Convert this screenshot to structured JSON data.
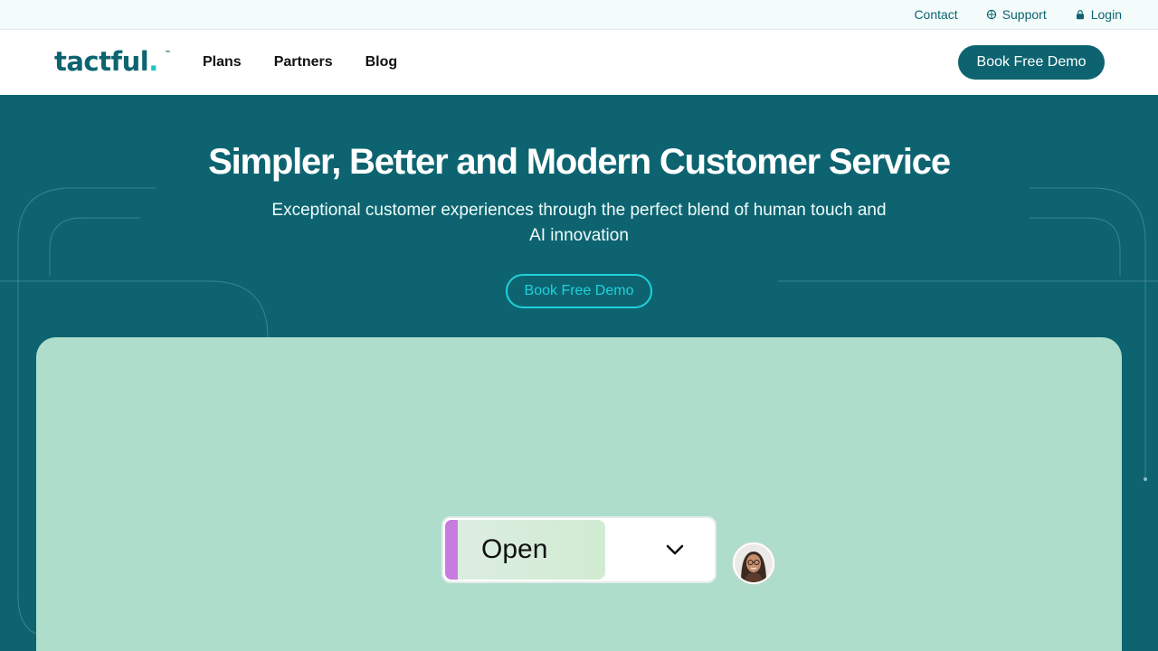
{
  "topbar": {
    "contact": "Contact",
    "support": "Support",
    "login": "Login",
    "icons": {
      "support": "globe-icon",
      "login": "lock-icon"
    }
  },
  "navbar": {
    "logo_text": "tactful",
    "logo_dot": ".",
    "logo_tm": "™",
    "links": [
      "Plans",
      "Partners",
      "Blog"
    ],
    "cta": "Book Free Demo"
  },
  "hero": {
    "title": "Simpler, Better and Modern Customer Service",
    "subtitle": "Exceptional customer experiences through the perfect blend of human touch and AI innovation",
    "cta": "Book Free Demo"
  },
  "showcase": {
    "status_label": "Open",
    "dropdown_icon": "chevron-down-icon",
    "avatar_icon": "user-avatar"
  },
  "colors": {
    "brand": "#0d6470",
    "accent": "#1fd1dd",
    "showcase_bg": "#aeddcc",
    "status_accent": "#c77ddf"
  }
}
